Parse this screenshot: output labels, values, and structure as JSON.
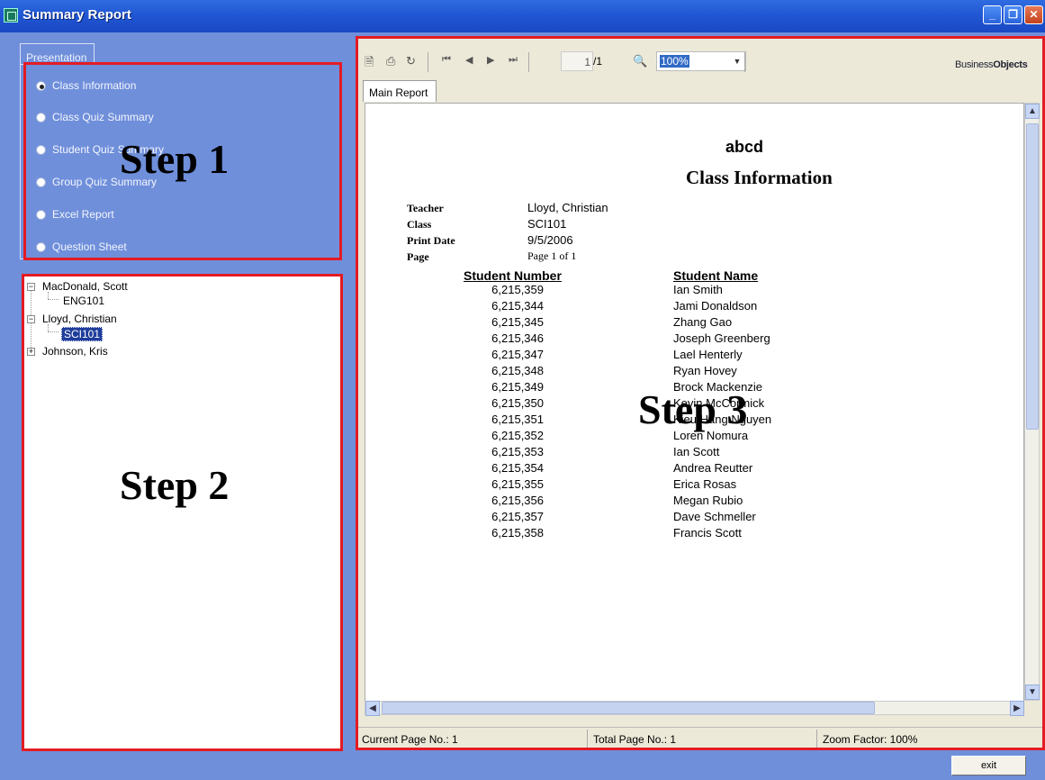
{
  "window": {
    "title": "Summary Report"
  },
  "presentation": {
    "group_label": "Presentation",
    "options": [
      {
        "label": "Class Information",
        "selected": true
      },
      {
        "label": "Class Quiz Summary",
        "selected": false
      },
      {
        "label": "Student Quiz Summary",
        "selected": false
      },
      {
        "label": "Group Quiz Summary",
        "selected": false
      },
      {
        "label": "Excel Report",
        "selected": false
      },
      {
        "label": "Question Sheet",
        "selected": false
      }
    ]
  },
  "tree": {
    "nodes": [
      {
        "label": "MacDonald, Scott",
        "expanded": true,
        "children": [
          "ENG101"
        ]
      },
      {
        "label": "Lloyd, Christian",
        "expanded": true,
        "children": [
          "SCI101"
        ],
        "selected_child": "SCI101"
      },
      {
        "label": "Johnson, Kris",
        "expanded": false,
        "children": []
      }
    ]
  },
  "steps": {
    "step1": "Step 1",
    "step2": "Step 2",
    "step3": "Step 3"
  },
  "viewer": {
    "page_current": "1",
    "page_total": "/1",
    "zoom": "100%",
    "logo_prefix": "Business",
    "logo_suffix": "Objects",
    "tab": "Main Report",
    "status": {
      "current_page": "Current Page No.: 1",
      "total_page": "Total Page No.: 1",
      "zoom_factor": "Zoom Factor: 100%"
    }
  },
  "report": {
    "org": "abcd",
    "title": "Class Information",
    "fields": [
      {
        "label": "Teacher",
        "value": "Lloyd, Christian"
      },
      {
        "label": "Class",
        "value": "SCI101"
      },
      {
        "label": "Print Date",
        "value": "9/5/2006"
      },
      {
        "label": "Page",
        "value": "Page 1 of 1"
      }
    ],
    "headers": {
      "number": "Student Number",
      "name": "Student Name"
    },
    "students": [
      {
        "number": "6,215,359",
        "name": "Ian Smith"
      },
      {
        "number": "6,215,344",
        "name": "Jami Donaldson"
      },
      {
        "number": "6,215,345",
        "name": "Zhang Gao"
      },
      {
        "number": "6,215,346",
        "name": "Joseph Greenberg"
      },
      {
        "number": "6,215,347",
        "name": "Lael Henterly"
      },
      {
        "number": "6,215,348",
        "name": "Ryan Hovey"
      },
      {
        "number": "6,215,349",
        "name": "Brock Mackenzie"
      },
      {
        "number": "6,215,350",
        "name": "Kevin McCormick"
      },
      {
        "number": "6,215,351",
        "name": "Kieu Hang Nguyen"
      },
      {
        "number": "6,215,352",
        "name": "Loren Nomura"
      },
      {
        "number": "6,215,353",
        "name": "Ian Scott"
      },
      {
        "number": "6,215,354",
        "name": "Andrea Reutter"
      },
      {
        "number": "6,215,355",
        "name": "Erica Rosas"
      },
      {
        "number": "6,215,356",
        "name": "Megan Rubio"
      },
      {
        "number": "6,215,357",
        "name": "Dave Schmeller"
      },
      {
        "number": "6,215,358",
        "name": "Francis Scott"
      }
    ]
  },
  "footer": {
    "exit_label": "exit"
  }
}
